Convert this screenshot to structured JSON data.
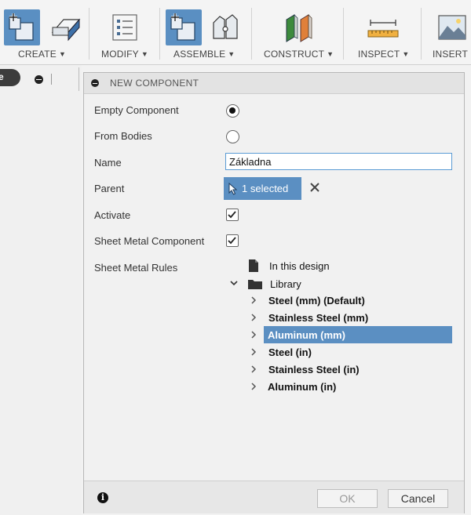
{
  "toolbar": {
    "groups": [
      {
        "label": "CREATE",
        "icon": "create-sketch-icon"
      },
      {
        "label": "MODIFY",
        "icon": "modify-icon"
      },
      {
        "label": "ASSEMBLE",
        "icon": "new-component-icon"
      },
      {
        "label": "CONSTRUCT",
        "icon": "construct-plane-icon"
      },
      {
        "label": "INSPECT",
        "icon": "measure-icon"
      },
      {
        "label": "INSERT",
        "icon": "insert-image-icon"
      }
    ],
    "caret": "▼"
  },
  "left_panel": {
    "pill_text": "e"
  },
  "dialog": {
    "title": "NEW COMPONENT",
    "fields": {
      "empty_component": {
        "label": "Empty Component",
        "checked": true
      },
      "from_bodies": {
        "label": "From Bodies",
        "checked": false
      },
      "name": {
        "label": "Name",
        "value": "Základna"
      },
      "parent": {
        "label": "Parent",
        "selection": "1 selected"
      },
      "activate": {
        "label": "Activate",
        "checked": true
      },
      "sheet_metal_component": {
        "label": "Sheet Metal Component",
        "checked": true
      },
      "sheet_metal_rules": {
        "label": "Sheet Metal Rules"
      }
    },
    "rules_tree": {
      "in_this_design": "In this design",
      "library": "Library",
      "items": [
        {
          "label": "Steel (mm) (Default)",
          "selected": false
        },
        {
          "label": "Stainless Steel (mm)",
          "selected": false
        },
        {
          "label": "Aluminum (mm)",
          "selected": true
        },
        {
          "label": "Steel (in)",
          "selected": false
        },
        {
          "label": "Stainless Steel (in)",
          "selected": false
        },
        {
          "label": "Aluminum (in)",
          "selected": false
        }
      ]
    },
    "footer": {
      "ok": "OK",
      "cancel": "Cancel"
    }
  },
  "colors": {
    "accent": "#5b8fc2",
    "input_border": "#5a9bd4"
  }
}
